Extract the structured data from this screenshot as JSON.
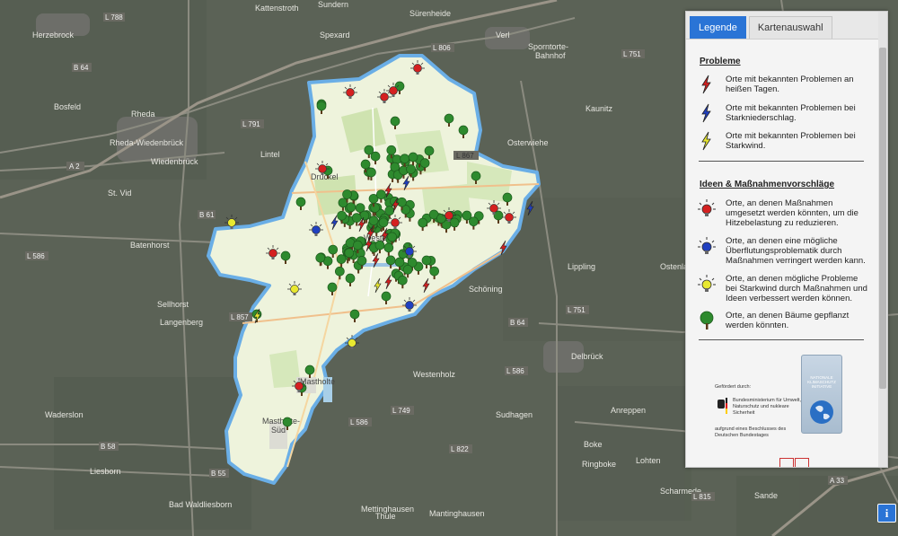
{
  "colors": {
    "map_background": "#5b6256",
    "region_fill": "#eef3dc",
    "region_border": "#6aaee6",
    "accent_tab": "#2a74d6",
    "marker_red": "#d42020",
    "marker_blue": "#2040c0",
    "marker_yellow": "#e8e830",
    "tree_green": "#2e8a2e"
  },
  "map": {
    "places_outside": [
      "Kattenstroth",
      "Sundern",
      "Sürenheide",
      "Herzebrock",
      "Verl",
      "Sporntorte-Bahnhof",
      "Bosfeld",
      "Spexard",
      "Kaunitz",
      "Rheda",
      "Rheda-Wiedenbrück",
      "Wiedenbrück",
      "Lintel",
      "Osterwiehe",
      "St. Vid",
      "Batenhorst",
      "Sellhorst",
      "Langenberg",
      "Lippling",
      "Ostenland",
      "Schöning",
      "Delbrück",
      "Westenholz",
      "Waderslon",
      "Sudhagen",
      "Anreppen",
      "Boke",
      "Ringboke",
      "Lohten",
      "Sande",
      "Scharmede",
      "Bad Waldliesborn",
      "Liesborn",
      "Mettinghausen",
      "Mantinghausen",
      "Thule"
    ],
    "places_inside": [
      "Druckel",
      "Mastholte",
      "Mastholte-Süd",
      "Westerloh"
    ],
    "roads": [
      "L 788",
      "L 806",
      "L 791",
      "A 2",
      "B 64",
      "B 61",
      "L 586",
      "L 857",
      "L 867",
      "L 751",
      "L 585",
      "L 749",
      "L 586",
      "L 822",
      "B 58",
      "B 55",
      "L 586",
      "L 751",
      "L 815",
      "A 33",
      "B 64",
      "L 822"
    ]
  },
  "panel": {
    "tabs": [
      {
        "label": "Legende",
        "active": true
      },
      {
        "label": "Kartenauswahl",
        "active": false
      }
    ],
    "sections": [
      {
        "title": "Probleme",
        "items": [
          {
            "icon": "red-lightning-icon",
            "text": "Orte mit bekannten Problemen an heißen Tagen."
          },
          {
            "icon": "blue-lightning-icon",
            "text": "Orte mit bekannten Problemen bei Starkniederschlag."
          },
          {
            "icon": "yellow-lightning-icon",
            "text": "Orte mit bekannten Problemen bei Starkwind."
          }
        ]
      },
      {
        "title": "Ideen & Maßnahmenvorschläge",
        "items": [
          {
            "icon": "red-lightbulb-icon",
            "text": "Orte, an denen Maßnahmen umgesetzt werden könnten, um die Hitzebelastung zu reduzieren."
          },
          {
            "icon": "blue-lightbulb-icon",
            "text": "Orte, an denen eine mögliche Überflutungsproblematik durch Maßnahmen verringert werden kann."
          },
          {
            "icon": "yellow-lightbulb-icon",
            "text": "Orte, an denen mögliche Probleme bei Starkwind durch Maßnahmen und Ideen verbessert werden können."
          },
          {
            "icon": "tree-icon",
            "text": "Orte, an denen Bäume gepflanzt werden könnten."
          }
        ]
      }
    ],
    "funding": {
      "label": "Gefördert durch:",
      "ministry": "Bundesministerium für Umwelt, Naturschutz und nukleare Sicherheit",
      "note": "aufgrund eines Beschlusses des Deutschen Bundestages",
      "badge": "NATIONALE KLIMASCHUTZ INITIATIVE"
    }
  },
  "info_button": {
    "label": "i"
  }
}
